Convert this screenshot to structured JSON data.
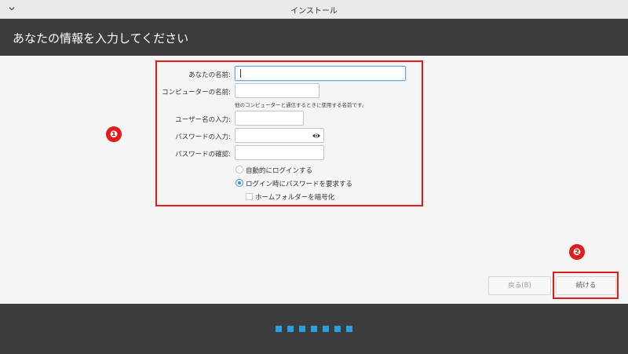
{
  "window": {
    "title": "インストール"
  },
  "header": {
    "title": "あなたの情報を入力してください"
  },
  "form": {
    "name_label": "あなたの名前:",
    "name_value": "",
    "computer_label": "コンピューターの名前:",
    "computer_value": "",
    "computer_hint": "他のコンピューターと通信するときに使用する名前です。",
    "username_label": "ユーザー名の入力:",
    "username_value": "",
    "password_label": "パスワードの入力:",
    "password_value": "",
    "confirm_label": "パスワードの確認:",
    "confirm_value": "",
    "auto_login_label": "自動的にログインする",
    "require_password_label": "ログイン時にパスワードを要求する",
    "encrypt_home_label": "ホームフォルダーを暗号化",
    "auto_login_selected": false,
    "require_password_selected": true,
    "encrypt_home_checked": false
  },
  "annotations": {
    "marker1": "❶",
    "marker2": "❷"
  },
  "buttons": {
    "back_label": "戻る(B)",
    "next_label": "続ける"
  },
  "progress": {
    "total_steps": 7
  },
  "colors": {
    "header_bg": "#3c3c3c",
    "accent": "#2b9fe0",
    "annotation_red": "#e21b1b"
  }
}
